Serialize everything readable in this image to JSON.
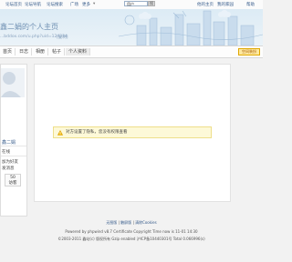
{
  "topnav": {
    "links": [
      "论坛首页",
      "论坛导航",
      "论坛搜索",
      "广场",
      "更多"
    ],
    "search_value": "用户",
    "search_button": "搜",
    "right_links": [
      "他的主页",
      "我的家园",
      "帮助"
    ]
  },
  "banner": {
    "title": "鑫二娟的个人主页",
    "url": "...bddox.com/u.php?uid=124334",
    "copy_link": "[复制]"
  },
  "tabs": [
    "首页",
    "日志",
    "相册",
    "帖子",
    "个人资料"
  ],
  "theme_button": "空间装扮",
  "sidebar": {
    "user_name": "鑫二娟",
    "items": [
      "在线",
      "加为好友",
      "发消息"
    ],
    "stat_value": "50",
    "stat_label": "访客"
  },
  "notice": {
    "text": "对方设置了隐私，您没有权限查看"
  },
  "footer": {
    "links": [
      "无图版",
      "触屏版",
      "清除Cookies"
    ],
    "line2": "Powered by phpwind v8.7 Certificate Copyright Time now is 11-01 14:30",
    "line3": "©2003-2011 鑫站(c) 版权所有 Gzip enabled 沪ICP备10440301号 Total 0.066996(s)"
  },
  "colors": {
    "accent": "#355a8a",
    "notice_bg": "#fdf9d8",
    "theme_button_bg": "#ffe9a0"
  }
}
